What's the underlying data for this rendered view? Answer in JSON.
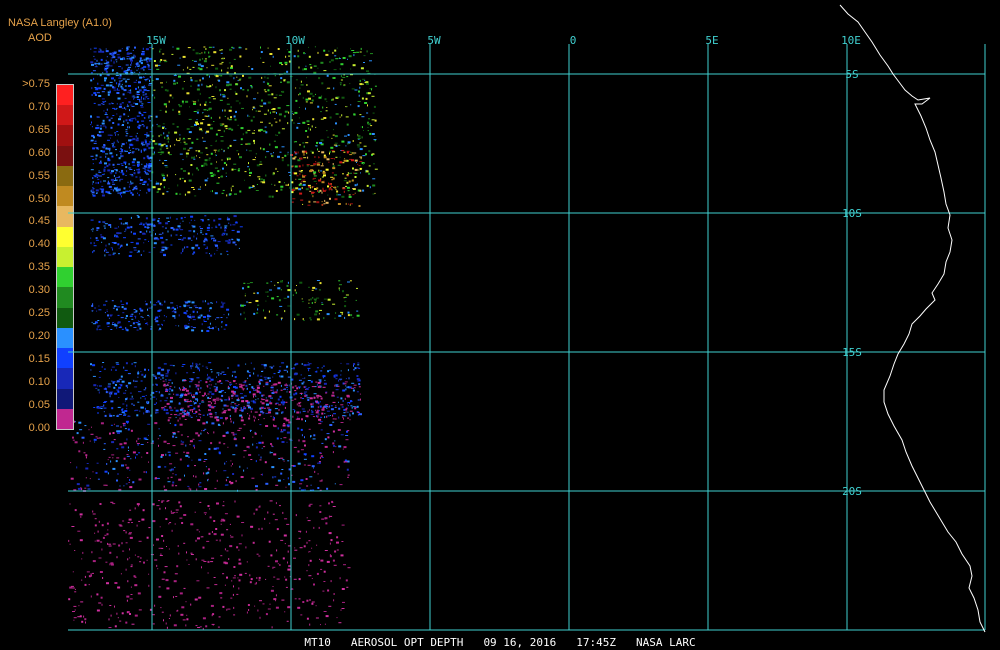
{
  "header": {
    "source": "NASA Langley (A1.0)",
    "parameter": "AOD"
  },
  "colorbar": {
    "labels": [
      ">0.75",
      "0.70",
      "0.65",
      "0.60",
      "0.55",
      "0.50",
      "0.45",
      "0.40",
      "0.35",
      "0.30",
      "0.25",
      "0.20",
      "0.15",
      "0.10",
      "0.05",
      "0.00"
    ],
    "colors": [
      "#ff2020",
      "#d01818",
      "#a01010",
      "#7a1010",
      "#8a6a10",
      "#c08a20",
      "#e8b860",
      "#ffff30",
      "#c8f030",
      "#30d030",
      "#208a20",
      "#105a10",
      "#2a90ff",
      "#1040ff",
      "#1828b8",
      "#101878",
      "#c02890"
    ]
  },
  "map": {
    "lon_labels": [
      "15W",
      "10W",
      "5W",
      "0",
      "5E",
      "10E"
    ],
    "lat_labels": [
      "5S",
      "10S",
      "15S",
      "20S"
    ],
    "grid_color": "#40d0d0",
    "coast_color": "#ffffff"
  },
  "footer": {
    "product": "MT10",
    "title": "AEROSOL OPT DEPTH",
    "date": "09 16, 2016",
    "time": "17:45Z",
    "org": "NASA LARC"
  }
}
